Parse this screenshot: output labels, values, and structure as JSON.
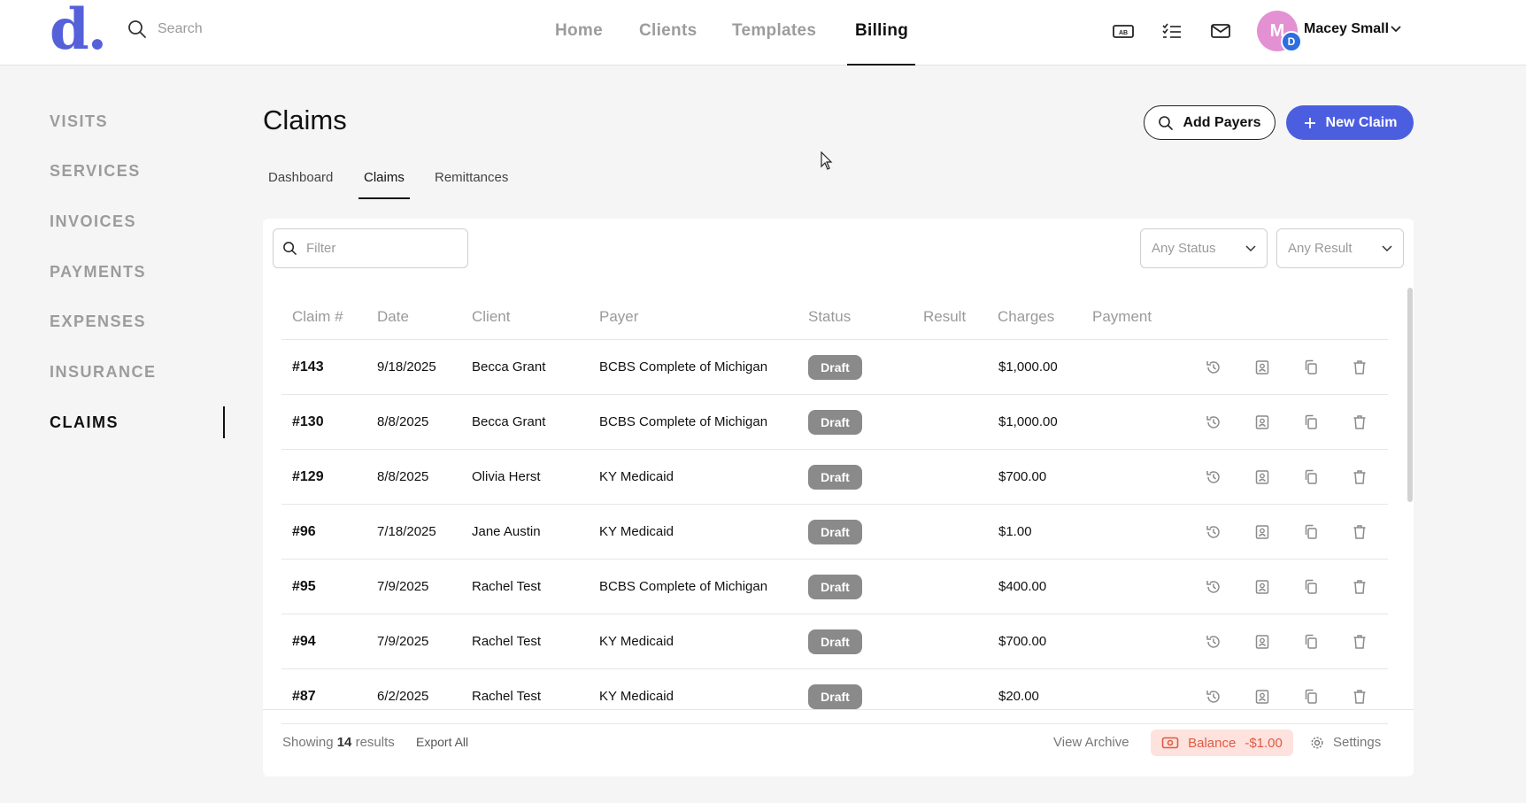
{
  "app": {
    "logo_text": "d.",
    "search_placeholder": "Search",
    "nav": [
      {
        "label": "Home"
      },
      {
        "label": "Clients"
      },
      {
        "label": "Templates"
      },
      {
        "label": "Billing"
      }
    ],
    "user": {
      "initial": "M",
      "badge": "D",
      "name": "Macey Small"
    }
  },
  "sidebar": {
    "items": [
      {
        "label": "VISITS"
      },
      {
        "label": "SERVICES"
      },
      {
        "label": "INVOICES"
      },
      {
        "label": "PAYMENTS"
      },
      {
        "label": "EXPENSES"
      },
      {
        "label": "INSURANCE"
      },
      {
        "label": "CLAIMS"
      }
    ]
  },
  "page": {
    "title": "Claims",
    "add_payers_label": "Add Payers",
    "new_claim_label": "New Claim",
    "tabs": [
      {
        "label": "Dashboard"
      },
      {
        "label": "Claims"
      },
      {
        "label": "Remittances"
      }
    ]
  },
  "filters": {
    "filter_placeholder": "Filter",
    "status": "Any Status",
    "result": "Any Result"
  },
  "table": {
    "headers": {
      "claim": "Claim #",
      "date": "Date",
      "client": "Client",
      "payer": "Payer",
      "status": "Status",
      "result": "Result",
      "charges": "Charges",
      "payment": "Payment"
    },
    "rows": [
      {
        "claim": "#143",
        "date": "9/18/2025",
        "client": "Becca Grant",
        "payer": "BCBS Complete of Michigan",
        "status": "Draft",
        "result": "",
        "charges": "$1,000.00",
        "payment": ""
      },
      {
        "claim": "#130",
        "date": "8/8/2025",
        "client": "Becca Grant",
        "payer": "BCBS Complete of Michigan",
        "status": "Draft",
        "result": "",
        "charges": "$1,000.00",
        "payment": ""
      },
      {
        "claim": "#129",
        "date": "8/8/2025",
        "client": "Olivia Herst",
        "payer": "KY Medicaid",
        "status": "Draft",
        "result": "",
        "charges": "$700.00",
        "payment": ""
      },
      {
        "claim": "#96",
        "date": "7/18/2025",
        "client": "Jane Austin",
        "payer": "KY Medicaid",
        "status": "Draft",
        "result": "",
        "charges": "$1.00",
        "payment": ""
      },
      {
        "claim": "#95",
        "date": "7/9/2025",
        "client": "Rachel Test",
        "payer": "BCBS Complete of Michigan",
        "status": "Draft",
        "result": "",
        "charges": "$400.00",
        "payment": ""
      },
      {
        "claim": "#94",
        "date": "7/9/2025",
        "client": "Rachel Test",
        "payer": "KY Medicaid",
        "status": "Draft",
        "result": "",
        "charges": "$700.00",
        "payment": ""
      },
      {
        "claim": "#87",
        "date": "6/2/2025",
        "client": "Rachel Test",
        "payer": "KY Medicaid",
        "status": "Draft",
        "result": "",
        "charges": "$20.00",
        "payment": ""
      }
    ]
  },
  "footer": {
    "showing_prefix": "Showing",
    "showing_count": "14",
    "showing_suffix": "results",
    "export_label": "Export All",
    "view_archive_label": "View Archive",
    "balance_label": "Balance",
    "balance_value": "-$1.00",
    "settings_label": "Settings"
  },
  "icons": {
    "header": [
      "ab-card-icon",
      "checklist-icon",
      "mail-icon"
    ],
    "row_actions": [
      "history-icon",
      "contact-card-icon",
      "copy-icon",
      "trash-icon"
    ]
  },
  "colors": {
    "brand": "#5561d9",
    "primary_button": "#4c5ee0",
    "draft_badge": "#8a8a8a",
    "balance_text": "#e05a44",
    "balance_bg": "#fde2dd",
    "avatar": "#e391d3"
  }
}
